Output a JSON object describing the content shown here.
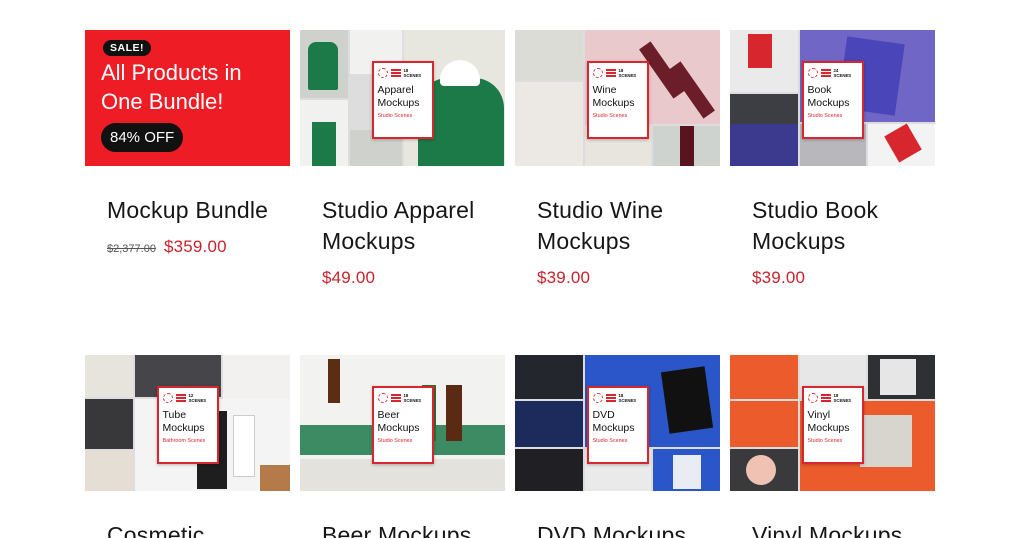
{
  "sale_card": {
    "badge": "SALE!",
    "headline": "All Products in One Bundle!",
    "discount": "84% OFF",
    "brand_color": "#ee1c25"
  },
  "products": [
    {
      "title": "Mockup Bundle",
      "old_price": "$2,377.00",
      "price": "$359.00"
    },
    {
      "title": "Studio Apparel Mockups",
      "price": "$49.00",
      "label": {
        "count": "18\nSCENES",
        "name": "Apparel Mockups",
        "sub": "Studio Scenes"
      }
    },
    {
      "title": "Studio Wine Mockups",
      "price": "$39.00",
      "label": {
        "count": "18\nSCENES",
        "name": "Wine Mockups",
        "sub": "Studio Scenes"
      }
    },
    {
      "title": "Studio Book Mockups",
      "price": "$39.00",
      "label": {
        "count": "24\nSCENES",
        "name": "Book Mockups",
        "sub": "Studio Scenes"
      }
    },
    {
      "title": "Cosmetic",
      "label": {
        "count": "12\nSCENES",
        "name": "Tube Mockups",
        "sub": "Bathroom Scenes"
      }
    },
    {
      "title": "Beer Mockups",
      "label": {
        "count": "18\nSCENES",
        "name": "Beer Mockups",
        "sub": "Studio Scenes"
      }
    },
    {
      "title": "DVD Mockups",
      "label": {
        "count": "18\nSCENES",
        "name": "DVD Mockups",
        "sub": "Studio Scenes"
      }
    },
    {
      "title": "Vinyl Mockups",
      "label": {
        "count": "18\nSCENES",
        "name": "Vinyl Mockups",
        "sub": "Studio Scenes"
      }
    }
  ],
  "colors": {
    "price": "#c8232c",
    "label_border": "#d8262f"
  }
}
